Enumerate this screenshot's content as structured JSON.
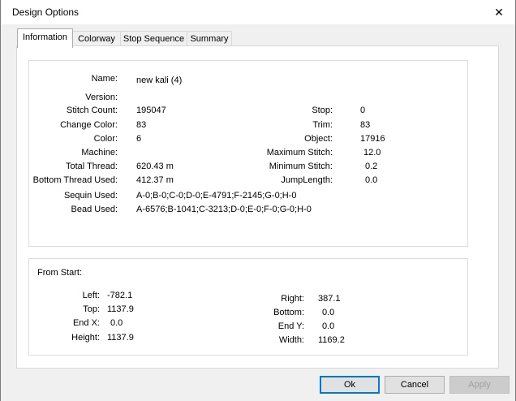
{
  "window": {
    "title": "Design Options",
    "close_glyph": "✕"
  },
  "tabs": [
    "Information",
    "Colorway",
    "Stop Sequence",
    "Summary"
  ],
  "info": {
    "name_label": "Name:",
    "name_value": "new kali (4)",
    "version_label": "Version:",
    "version_value": "",
    "stitch_count_label": "Stitch Count:",
    "stitch_count_value": "195047",
    "change_color_label": "Change Color:",
    "change_color_value": "83",
    "color_label": "Color:",
    "color_value": "6",
    "machine_label": "Machine:",
    "machine_value": "",
    "total_thread_label": "Total Thread:",
    "total_thread_value": "620.43 m",
    "bottom_thread_label": "Bottom Thread Used:",
    "bottom_thread_value": "412.37 m",
    "sequin_label": "Sequin Used:",
    "sequin_value": "A-0;B-0;C-0;D-0;E-4791;F-2145;G-0;H-0",
    "bead_label": "Bead Used:",
    "bead_value": "A-6576;B-1041;C-3213;D-0;E-0;F-0;G-0;H-0",
    "stop_label": "Stop:",
    "stop_value": "0",
    "trim_label": "Trim:",
    "trim_value": "83",
    "object_label": "Object:",
    "object_value": "17916",
    "max_stitch_label": "Maximum Stitch:",
    "max_stitch_value": "12.0",
    "min_stitch_label": "Minimum Stitch:",
    "min_stitch_value": "0.2",
    "jump_label": "JumpLength:",
    "jump_value": "0.0"
  },
  "from_start": {
    "heading": "From Start:",
    "left_label": "Left:",
    "left_value": "-782.1",
    "top_label": "Top:",
    "top_value": "1137.9",
    "endx_label": "End X:",
    "endx_value": "0.0",
    "height_label": "Height:",
    "height_value": "1137.9",
    "right_label": "Right:",
    "right_value": "387.1",
    "bottom_label": "Bottom:",
    "bottom_value": "0.0",
    "endy_label": "End Y:",
    "endy_value": "0.0",
    "width_label": "Width:",
    "width_value": "1169.2"
  },
  "buttons": {
    "ok": "Ok",
    "cancel": "Cancel",
    "apply": "Apply"
  }
}
